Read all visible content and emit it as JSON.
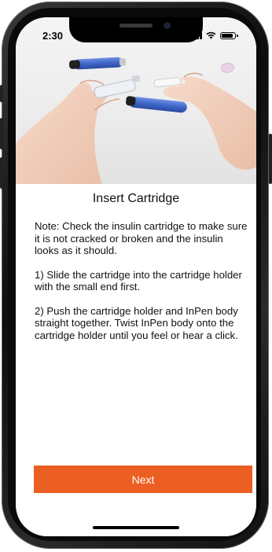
{
  "status_bar": {
    "time": "2:30",
    "signal_icon": "cellular-signal-icon",
    "wifi_icon": "wifi-icon",
    "battery_icon": "battery-icon"
  },
  "hero": {
    "icon": "insulin-pen-cartridge-photo"
  },
  "page": {
    "title": "Insert Cartridge",
    "paragraphs": [
      "Note: Check the insulin cartridge to make sure it is not cracked or broken and the insulin looks as it should.",
      "1) Slide the cartridge into the cartridge holder with the small end first.",
      "2) Push the cartridge holder and InPen body straight together. Twist InPen body onto the cartridge holder until you feel or hear a click."
    ]
  },
  "actions": {
    "next_label": "Next"
  },
  "colors": {
    "accent": "#ec5f23",
    "pen_body": "#3f66c9",
    "background": "#ffffff"
  }
}
